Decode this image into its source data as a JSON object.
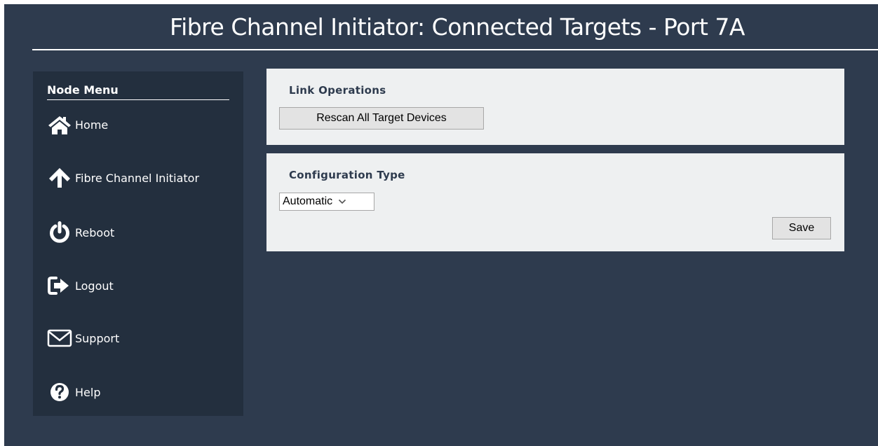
{
  "header": {
    "title": "Fibre Channel Initiator: Connected Targets - Port 7A"
  },
  "sidebar": {
    "heading": "Node Menu",
    "items": [
      {
        "label": "Home",
        "icon": "home-icon"
      },
      {
        "label": "Fibre Channel Initiator",
        "icon": "arrow-up-icon"
      },
      {
        "label": "Reboot",
        "icon": "power-icon"
      },
      {
        "label": "Logout",
        "icon": "logout-icon"
      },
      {
        "label": "Support",
        "icon": "envelope-icon"
      },
      {
        "label": "Help",
        "icon": "help-icon"
      }
    ]
  },
  "link_operations": {
    "heading": "Link Operations",
    "rescan_label": "Rescan All Target Devices"
  },
  "configuration": {
    "heading": "Configuration Type",
    "selected": "Automatic",
    "save_label": "Save"
  },
  "colors": {
    "page_background": "#2e3b4e",
    "sidebar_background": "#232f3e",
    "panel_background": "#eef0f1",
    "text_light": "#ffffff"
  }
}
